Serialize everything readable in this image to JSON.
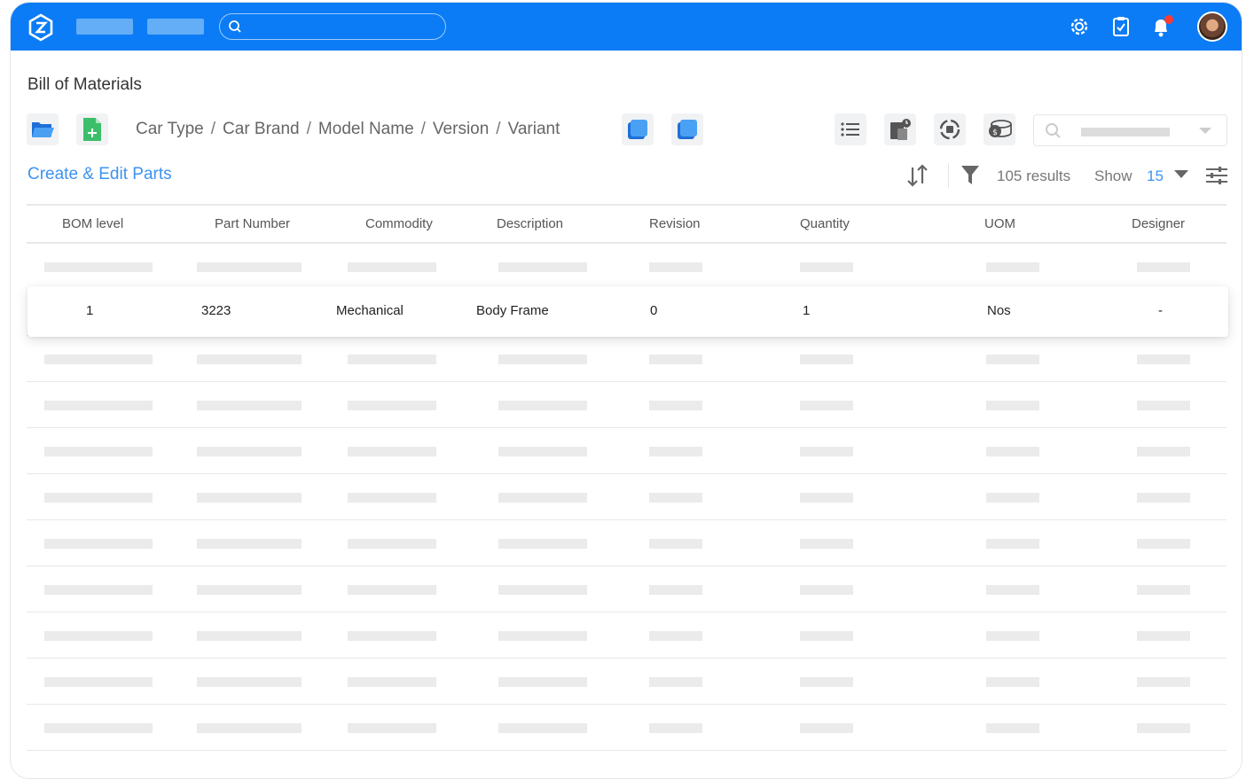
{
  "page": {
    "title": "Bill of Materials",
    "create_link": "Create & Edit Parts",
    "results": "105 results",
    "show_label": "Show",
    "show_value": "15"
  },
  "breadcrumb": [
    "Car Type",
    "Car Brand",
    "Model Name",
    "Version",
    "Variant"
  ],
  "table": {
    "columns": [
      "BOM level",
      "Part Number",
      "Commodity",
      "Description",
      "Revision",
      "Quantity",
      "UOM",
      "Designer"
    ],
    "highlighted_row": [
      "1",
      "3223",
      "Mechanical",
      "Body Frame",
      "0",
      "1",
      "Nos",
      "-"
    ]
  },
  "icons": {
    "logo": "app-logo-icon",
    "settings": "settings-gear-icon",
    "tasks": "clipboard-check-icon",
    "notifications": "bell-icon",
    "open": "folder-open-icon",
    "new": "new-file-icon",
    "copy1": "copy-icon",
    "copy2": "duplicate-icon",
    "list": "list-icon",
    "clipboard": "clipboard-icon",
    "sync": "sync-icon",
    "cost": "coins-icon",
    "sort": "sort-icon",
    "filter": "filter-icon",
    "columns": "sliders-icon"
  },
  "colors": {
    "topbar": "#0b7cf5",
    "accent": "#3d93f0",
    "notification": "#ff3b30"
  }
}
